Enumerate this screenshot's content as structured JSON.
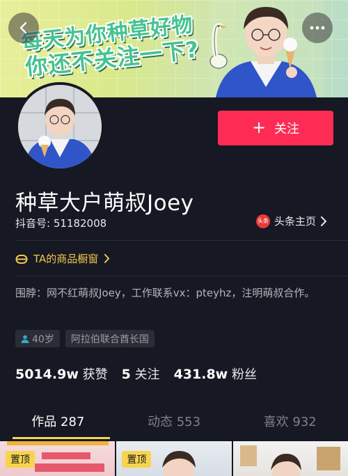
{
  "banner": {
    "line1": "每天为你种草好物",
    "line2": "你还不关注一下?"
  },
  "nav": {
    "back_icon": "chevron-left-icon",
    "more_icon": "more-dots-icon"
  },
  "profile": {
    "follow_label": "关注",
    "name": "种草大户萌叔Joey",
    "douyin_id": "抖音号: 51182008",
    "toutiao_logo_text": "头条",
    "toutiao_label": "头条主页",
    "shop_label": "TA的商品橱窗",
    "bio": "围脖：网不红萌叔Joey，工作联系vx：pteyhz，注明萌叔合作。",
    "tags": {
      "age": "40岁",
      "location": "阿拉伯联合酋长国"
    }
  },
  "stats": {
    "likes_value": "5014.9w",
    "likes_label": "获赞",
    "following_value": "5",
    "following_label": "关注",
    "followers_value": "431.8w",
    "followers_label": "粉丝"
  },
  "tabs": [
    {
      "label": "作品 287",
      "active": true
    },
    {
      "label": "动态 553",
      "active": false
    },
    {
      "label": "喜欢 932",
      "active": false
    }
  ],
  "grid": {
    "pinned_label": "置顶"
  },
  "colors": {
    "background": "#161823",
    "follow_button": "#fe2c55",
    "accent_yellow": "#f7d44b",
    "banner_text": "#44c38f"
  }
}
